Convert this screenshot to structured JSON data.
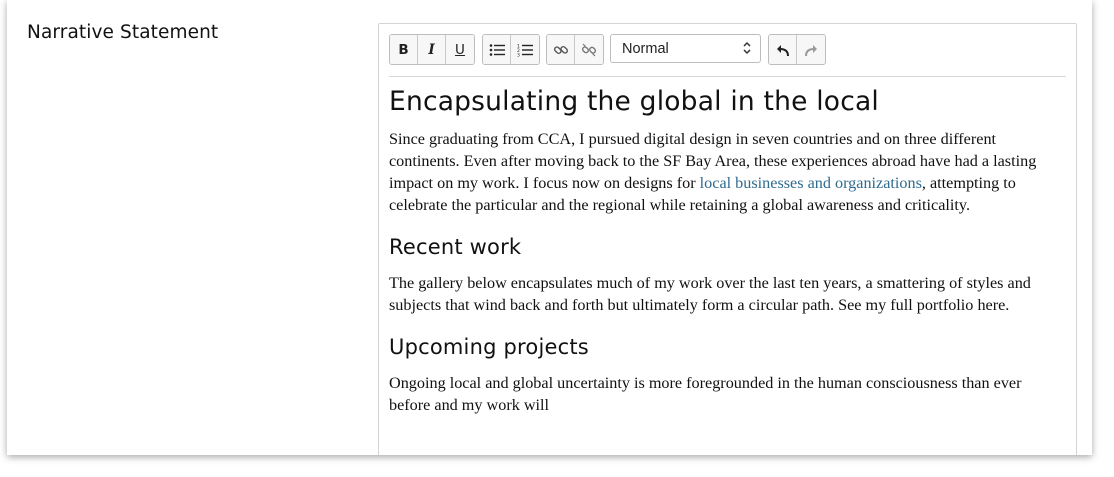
{
  "field": {
    "label": "Narrative Statement"
  },
  "toolbar": {
    "format_buttons": [
      {
        "name": "bold-button",
        "icon": "bold-icon",
        "glyph": "B"
      },
      {
        "name": "italic-button",
        "icon": "italic-icon",
        "glyph": "I"
      },
      {
        "name": "underline-button",
        "icon": "underline-icon",
        "glyph": "U"
      }
    ],
    "list_buttons": [
      {
        "name": "bullet-list-button",
        "icon": "bullet-list-icon"
      },
      {
        "name": "numbered-list-button",
        "icon": "numbered-list-icon"
      }
    ],
    "link_buttons": [
      {
        "name": "link-button",
        "icon": "link-icon"
      },
      {
        "name": "unlink-button",
        "icon": "unlink-icon"
      }
    ],
    "block_format": {
      "value": "Normal"
    },
    "history_buttons": [
      {
        "name": "undo-button",
        "icon": "undo-icon"
      },
      {
        "name": "redo-button",
        "icon": "redo-icon",
        "disabled": true
      }
    ]
  },
  "content": {
    "title": "Encapsulating the global in the local",
    "p1_before": "Since graduating from CCA, I pursued digital design in seven countries and on three different continents. Even after moving back to the SF Bay Area, these experiences abroad have had a lasting impact on my work. I focus now on designs for ",
    "p1_link": "local businesses and organizations",
    "p1_after": ", attempting to celebrate the particular and the regional while retaining a global awareness and criticality.",
    "h_recent": "Recent work",
    "p2": "The gallery below encapsulates much of my work over the last ten years, a smattering of styles and subjects that wind back and forth but ultimately form a circular path. See my full portfolio here.",
    "h_upcoming": "Upcoming projects",
    "p3": "Ongoing local and global uncertainty is more foregrounded in the human consciousness than ever before and my work will"
  },
  "colors": {
    "link": "#2f6b8f",
    "text": "#111111",
    "border": "#d4d4d4"
  }
}
